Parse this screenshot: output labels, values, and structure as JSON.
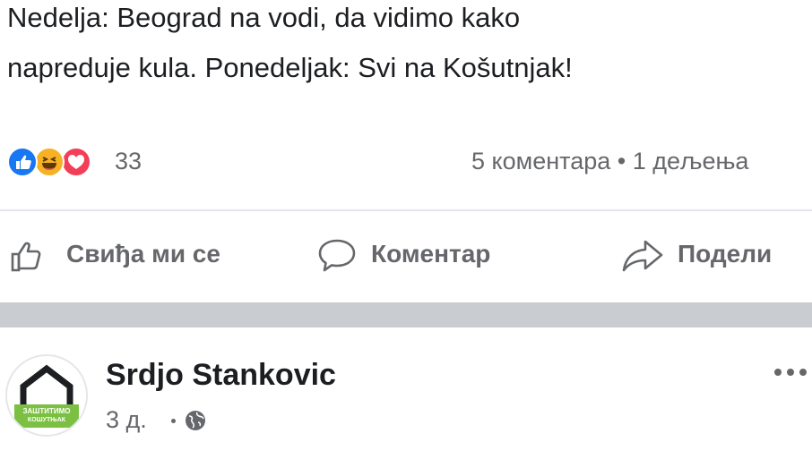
{
  "post": {
    "text_lines": [
      "Nedelja: Beograd na vodi, da vidimo kako",
      "napreduje kula. Ponedeljak: Svi na Košutnjak!"
    ],
    "reactions": {
      "icons": [
        "like-icon",
        "haha-icon",
        "love-icon"
      ],
      "count": "33"
    },
    "comments_shares": "5 коментара • 1 дељења"
  },
  "actions": {
    "like_label": "Свиђа ми се",
    "comment_label": "Коментар",
    "share_label": "Подели"
  },
  "next_post": {
    "author": "Srdjo Stankovic",
    "time": "3 д.",
    "privacy_icon": "globe-icon",
    "avatar_text_top": "ЗАШТИТИМО",
    "avatar_text_bottom": "КОШУТЊАК"
  },
  "colors": {
    "like_blue": "#1877f2",
    "haha_yellow": "#f7b125",
    "love_red": "#f33e58",
    "secondary_text": "#65676b",
    "avatar_green": "#7bc043"
  }
}
